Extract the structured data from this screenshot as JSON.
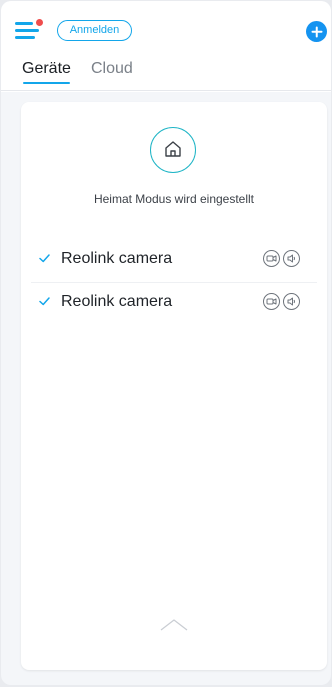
{
  "header": {
    "login_label": "Anmelden"
  },
  "tabs": [
    {
      "label": "Geräte",
      "active": true
    },
    {
      "label": "Cloud",
      "active": false
    }
  ],
  "mode": {
    "status": "Heimat Modus wird eingestellt",
    "icon": "home-icon"
  },
  "devices": [
    {
      "name": "Reolink camera",
      "checked": true,
      "icons": [
        "camera-icon",
        "speaker-icon"
      ]
    },
    {
      "name": "Reolink camera",
      "checked": true,
      "icons": [
        "camera-icon",
        "speaker-icon"
      ]
    }
  ],
  "colors": {
    "accent": "#13a6ea",
    "add_button": "#1493f0",
    "notification_dot": "#ef4d4d",
    "mode_ring": "#1fb5c6"
  }
}
